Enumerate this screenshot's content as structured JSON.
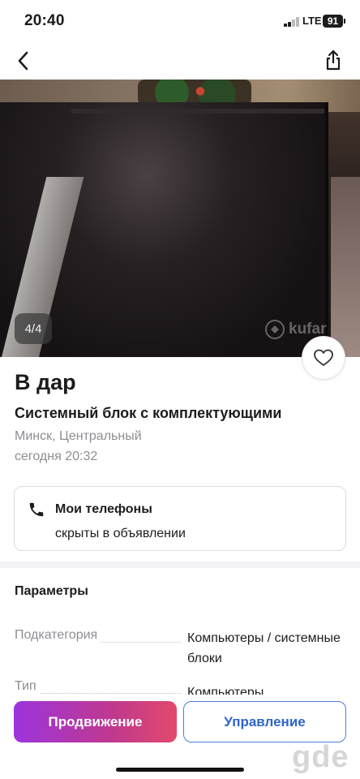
{
  "status_bar": {
    "time": "20:40",
    "network": "LTE",
    "battery": "91"
  },
  "nav": {
    "back_icon": "chevron-left-icon",
    "share_icon": "share-icon"
  },
  "photo": {
    "counter": "4/4",
    "watermark": "kufar"
  },
  "listing": {
    "title": "В дар",
    "subtitle": "Системный блок с комплектующими",
    "location": "Минск, Центральный",
    "date": "сегодня 20:32"
  },
  "phones": {
    "title": "Мои телефоны",
    "subtitle": "скрыты в объявлении",
    "icon": "phone-icon"
  },
  "params": {
    "title": "Параметры",
    "rows": [
      {
        "label": "Подкатегория",
        "value": "Компьютеры / системные блоки"
      },
      {
        "label": "Тип",
        "value": "Компьютеры"
      }
    ]
  },
  "actions": {
    "promote": "Продвижение",
    "manage": "Управление"
  },
  "colors": {
    "accent_blue": "#2e66cc",
    "promote_start": "#9c34dd",
    "promote_end": "#e1496d"
  },
  "site_watermark": "gde"
}
